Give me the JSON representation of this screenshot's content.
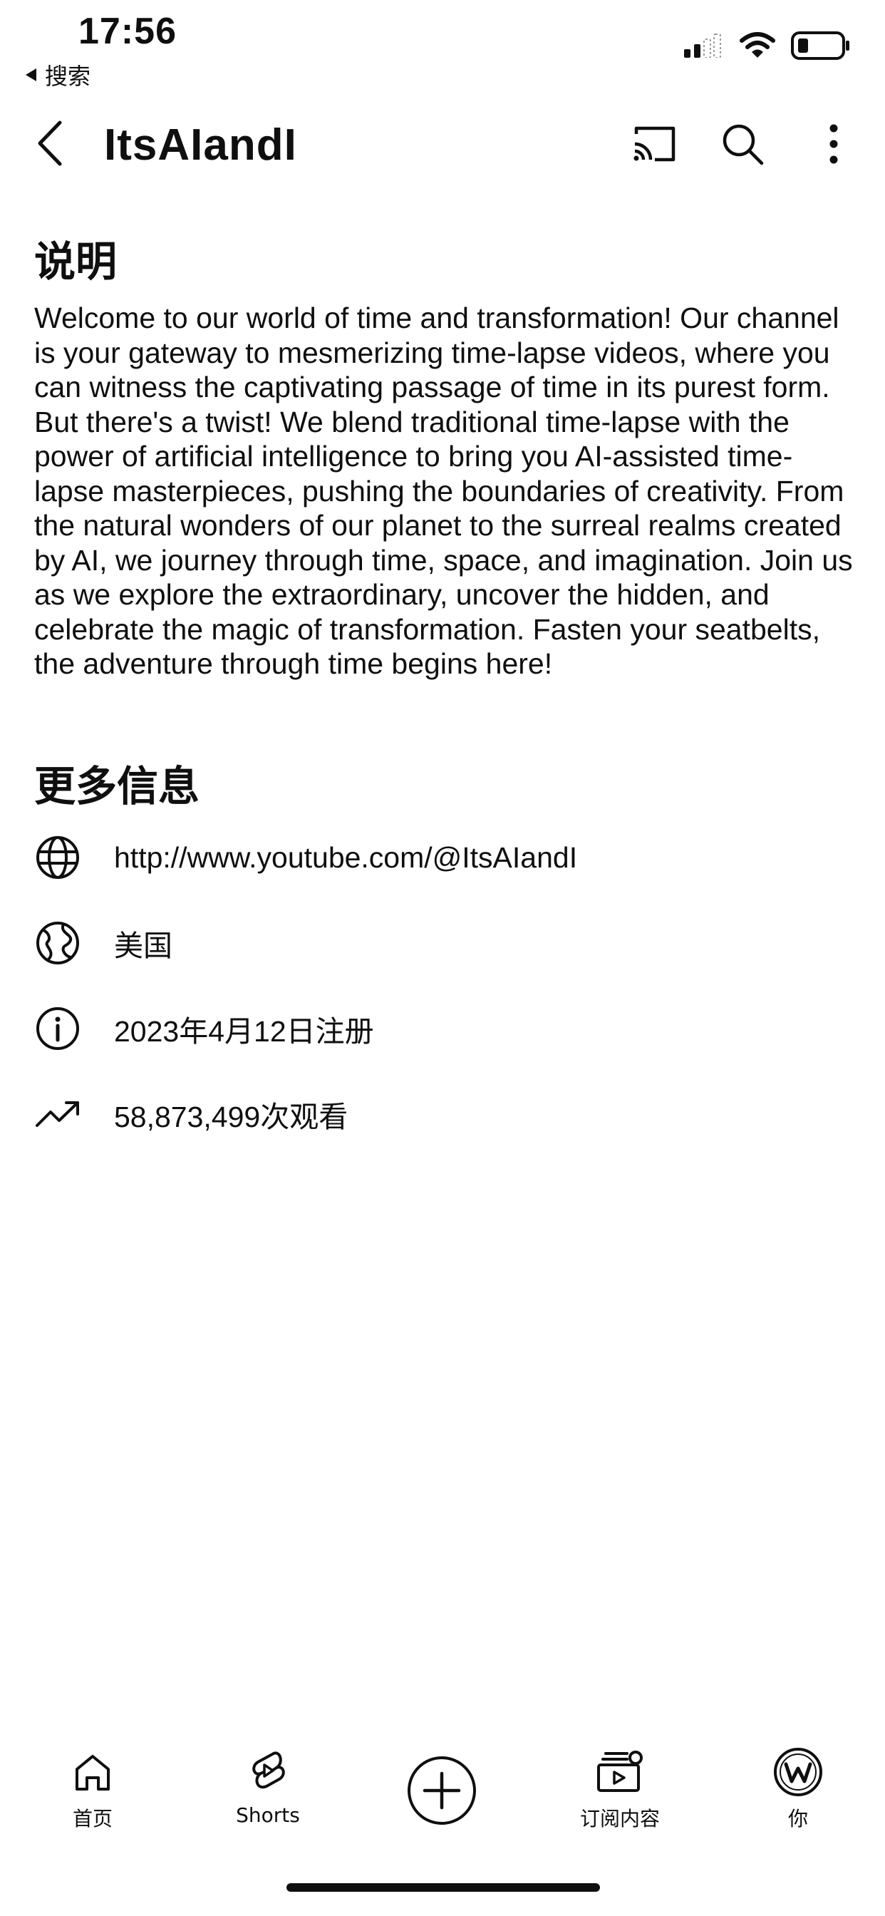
{
  "status_bar": {
    "time": "17:56",
    "back_label": "搜索"
  },
  "header": {
    "title": "ItsAIandI"
  },
  "description": {
    "title": "说明",
    "text": "Welcome to our world of time and transformation! Our channel is your gateway to mesmerizing time-lapse videos, where you can witness the captivating passage of time in its purest form. But there's a twist! We blend traditional time-lapse with the power of artificial intelligence to bring you AI-assisted time-lapse masterpieces, pushing the boundaries of creativity. From the natural wonders of our planet to the surreal realms created by AI, we journey through time, space, and imagination. Join us as we explore the extraordinary, uncover the hidden, and celebrate the magic of transformation. Fasten your seatbelts, the adventure through time begins here!"
  },
  "more_info": {
    "title": "更多信息",
    "link": "http://www.youtube.com/@ItsAIandI",
    "country": "美国",
    "joined": "2023年4月12日注册",
    "views": "58,873,499次观看"
  },
  "bottom_nav": {
    "home": "首页",
    "shorts": "Shorts",
    "subscriptions": "订阅内容",
    "you": "你"
  },
  "icons": {
    "status": [
      "signal-icon",
      "wifi-icon",
      "battery-icon"
    ],
    "header": [
      "back-arrow-icon",
      "cast-icon",
      "search-icon",
      "more-vert-icon"
    ],
    "info": [
      "globe-link-icon",
      "globe-country-icon",
      "info-icon",
      "trending-icon"
    ],
    "nav": [
      "home-icon",
      "shorts-icon",
      "create-icon",
      "subscriptions-icon",
      "avatar-icon"
    ]
  }
}
